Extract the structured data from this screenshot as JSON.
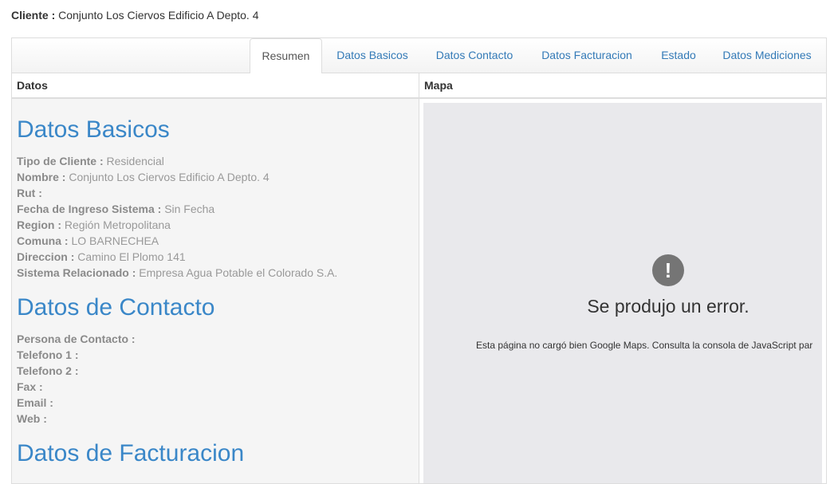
{
  "client": {
    "label": "Cliente :",
    "name": "Conjunto Los Ciervos Edificio A Depto. 4"
  },
  "tabs": [
    {
      "label": "Resumen",
      "active": true
    },
    {
      "label": "Datos Basicos"
    },
    {
      "label": "Datos Contacto"
    },
    {
      "label": "Datos Facturacion"
    },
    {
      "label": "Estado"
    },
    {
      "label": "Datos Mediciones"
    }
  ],
  "columns": {
    "left": "Datos",
    "right": "Mapa"
  },
  "basicos": {
    "title": "Datos Basicos",
    "fields": [
      {
        "label": "Tipo de Cliente :",
        "value": "Residencial"
      },
      {
        "label": "Nombre :",
        "value": "Conjunto Los Ciervos Edificio A Depto. 4"
      },
      {
        "label": "Rut :",
        "value": ""
      },
      {
        "label": "Fecha de Ingreso Sistema :",
        "value": "Sin Fecha"
      },
      {
        "label": "Region :",
        "value": "Región Metropolitana"
      },
      {
        "label": "Comuna :",
        "value": "LO BARNECHEA"
      },
      {
        "label": "Direccion :",
        "value": "Camino El Plomo 141"
      },
      {
        "label": "Sistema Relacionado :",
        "value": "Empresa Agua Potable el Colorado S.A."
      }
    ]
  },
  "contacto": {
    "title": "Datos de Contacto",
    "fields": [
      {
        "label": "Persona de Contacto :",
        "value": ""
      },
      {
        "label": "Telefono 1 :",
        "value": ""
      },
      {
        "label": "Telefono 2 :",
        "value": ""
      },
      {
        "label": "Fax :",
        "value": ""
      },
      {
        "label": "Email :",
        "value": ""
      },
      {
        "label": "Web :",
        "value": ""
      }
    ]
  },
  "facturacion": {
    "title": "Datos de Facturacion"
  },
  "map_error": {
    "icon": "!",
    "title": "Se produjo un error.",
    "message": "Esta página no cargó bien Google Maps. Consulta la consola de JavaScript par"
  }
}
